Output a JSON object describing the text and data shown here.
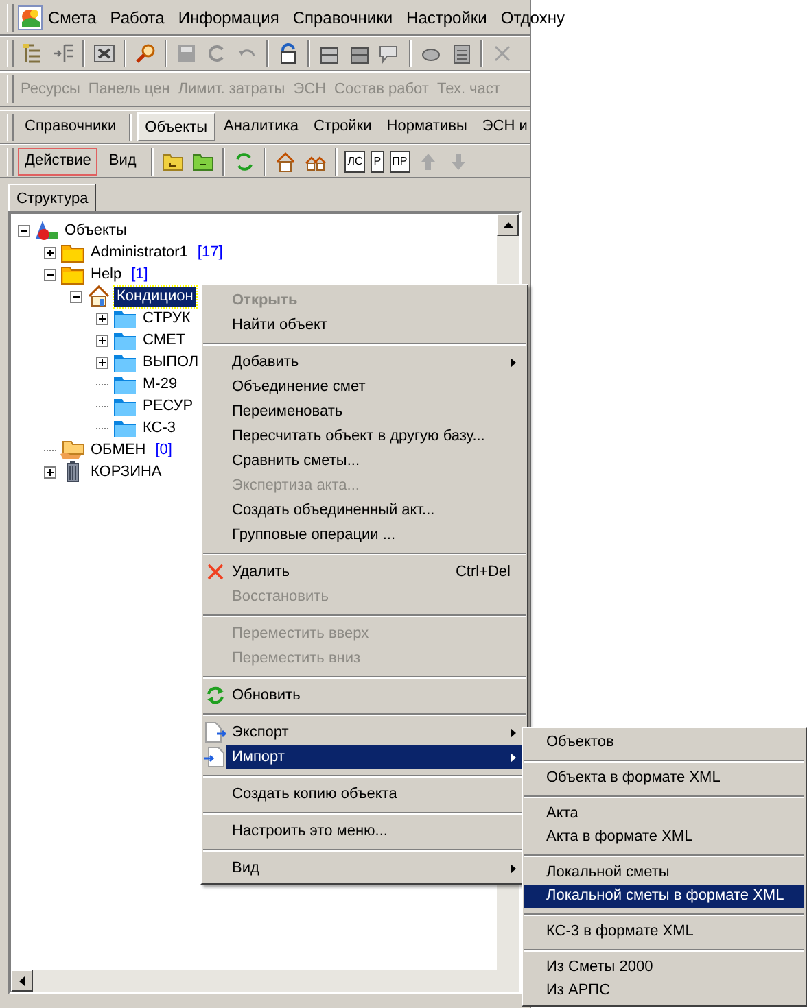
{
  "menubar": {
    "items": [
      {
        "label": "Смета",
        "selected": false
      },
      {
        "label": "Работа",
        "selected": false
      },
      {
        "label": "Информация",
        "selected": false
      },
      {
        "label": "Справочники",
        "selected": false
      },
      {
        "label": "Настройки",
        "selected": false
      },
      {
        "label": "Отдохну",
        "selected": false
      }
    ]
  },
  "toolbar_links": [
    {
      "label": "Ресурсы",
      "disabled": true
    },
    {
      "label": "Панель цен",
      "disabled": true
    },
    {
      "label": "Лимит. затраты",
      "disabled": true
    },
    {
      "label": "ЭСН",
      "disabled": true
    },
    {
      "label": "Состав работ",
      "disabled": true
    },
    {
      "label": "Тех. част",
      "disabled": true
    }
  ],
  "tabs": [
    {
      "label": "Справочники",
      "selected": false
    },
    {
      "label": "Объекты",
      "selected": true
    },
    {
      "label": "Аналитика",
      "selected": false
    },
    {
      "label": "Стройки",
      "selected": false
    },
    {
      "label": "Нормативы",
      "selected": false
    },
    {
      "label": "ЭСН и",
      "selected": false
    }
  ],
  "action_toolbar": {
    "buttons": [
      {
        "label": "Действие",
        "focused": true
      },
      {
        "label": "Вид",
        "focused": false
      }
    ],
    "doc_icons": [
      "ЛС",
      "Р",
      "ПР"
    ]
  },
  "panel_tab": {
    "label": "Структура",
    "selected": true
  },
  "tree": [
    {
      "label": "Объекты",
      "kind": "root",
      "selected": false,
      "expanded": true,
      "children": [
        {
          "label": "Administrator1",
          "count": "[17]",
          "kind": "user-folder",
          "selected": false,
          "expanded": false
        },
        {
          "label": "Help",
          "count": "[1]",
          "kind": "user-folder",
          "selected": false,
          "expanded": true,
          "children": [
            {
              "label": "Кондицион",
              "kind": "object",
              "selected": true,
              "expanded": true,
              "children": [
                {
                  "label": "СТРУК",
                  "kind": "folder",
                  "selected": false,
                  "expanded": false
                },
                {
                  "label": "СМЕТ",
                  "kind": "folder",
                  "selected": false,
                  "expanded": false
                },
                {
                  "label": "ВЫПОЛ",
                  "kind": "folder",
                  "selected": false,
                  "expanded": false
                },
                {
                  "label": "М-29",
                  "kind": "folder",
                  "selected": false
                },
                {
                  "label": "РЕСУР",
                  "kind": "folder",
                  "selected": false
                },
                {
                  "label": "КС-3",
                  "kind": "folder",
                  "selected": false
                }
              ]
            }
          ]
        },
        {
          "label": "ОБМЕН",
          "count": "[0]",
          "kind": "exchange",
          "selected": false
        },
        {
          "label": "КОРЗИНА",
          "kind": "trash",
          "selected": false,
          "expanded": false
        }
      ]
    }
  ],
  "context_menu": {
    "groups": [
      [
        {
          "label": "Открыть",
          "disabled": true,
          "default": true,
          "selected": false,
          "submenu": false
        },
        {
          "label": "Найти объект",
          "disabled": false,
          "default": false,
          "selected": false,
          "submenu": false
        }
      ],
      [
        {
          "label": "Добавить",
          "disabled": false,
          "default": false,
          "selected": false,
          "submenu": true
        },
        {
          "label": "Объединение смет",
          "disabled": false,
          "default": false,
          "selected": false,
          "submenu": false
        },
        {
          "label": "Переименовать",
          "disabled": false,
          "default": false,
          "selected": false,
          "submenu": false
        },
        {
          "label": "Пересчитать объект в другую базу...",
          "disabled": false,
          "default": false,
          "selected": false,
          "submenu": false
        },
        {
          "label": "Сравнить сметы...",
          "disabled": false,
          "default": false,
          "selected": false,
          "submenu": false
        },
        {
          "label": "Экспертиза акта...",
          "disabled": true,
          "default": false,
          "selected": false,
          "submenu": false
        },
        {
          "label": "Создать объединенный акт...",
          "disabled": false,
          "default": false,
          "selected": false,
          "submenu": false
        },
        {
          "label": "Групповые операции ...",
          "disabled": false,
          "default": false,
          "selected": false,
          "submenu": false
        }
      ],
      [
        {
          "label": "Удалить",
          "shortcut": "Ctrl+Del",
          "disabled": false,
          "default": false,
          "selected": false,
          "submenu": false
        },
        {
          "label": "Восстановить",
          "disabled": true,
          "default": false,
          "selected": false,
          "submenu": false
        }
      ],
      [
        {
          "label": "Переместить вверх",
          "disabled": true,
          "default": false,
          "selected": false,
          "submenu": false
        },
        {
          "label": "Переместить вниз",
          "disabled": true,
          "default": false,
          "selected": false,
          "submenu": false
        }
      ],
      [
        {
          "label": "Обновить",
          "disabled": false,
          "default": false,
          "selected": false,
          "submenu": false
        }
      ],
      [
        {
          "label": "Экспорт",
          "disabled": false,
          "default": false,
          "selected": false,
          "submenu": true
        },
        {
          "label": "Импорт",
          "disabled": false,
          "default": false,
          "selected": true,
          "submenu": true
        }
      ],
      [
        {
          "label": "Создать копию объекта",
          "disabled": false,
          "default": false,
          "selected": false,
          "submenu": false
        }
      ],
      [
        {
          "label": "Настроить это меню...",
          "disabled": false,
          "default": false,
          "selected": false,
          "submenu": false
        }
      ],
      [
        {
          "label": "Вид",
          "disabled": false,
          "default": false,
          "selected": false,
          "submenu": true
        }
      ]
    ]
  },
  "submenu": {
    "groups": [
      [
        {
          "label": "Объектов",
          "selected": false
        }
      ],
      [
        {
          "label": "Объекта в формате XML",
          "selected": false
        }
      ],
      [
        {
          "label": "Акта",
          "selected": false
        },
        {
          "label": "Акта в формате XML",
          "selected": false
        }
      ],
      [
        {
          "label": "Локальной сметы",
          "selected": false
        },
        {
          "label": "Локальной сметы в формате XML",
          "selected": true
        }
      ],
      [
        {
          "label": "КС-3 в формате XML",
          "selected": false
        }
      ],
      [
        {
          "label": "Из Сметы 2000",
          "selected": false
        },
        {
          "label": "Из АРПС",
          "selected": false
        }
      ]
    ]
  }
}
